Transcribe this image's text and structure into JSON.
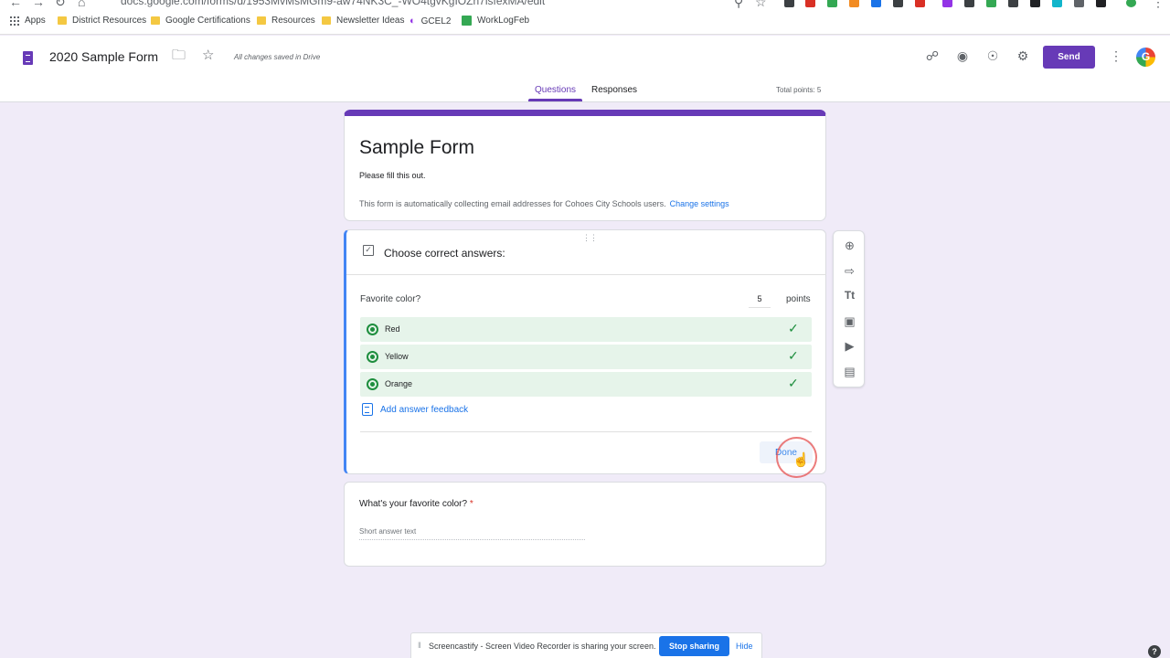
{
  "browser": {
    "url": "docs.google.com/forms/d/1953MvMsMGm9-aw74NK3C_-WO4tgvKgIOZn7lsfexMA/edit",
    "bookmarks": [
      "Apps",
      "District Resources",
      "Google Certifications",
      "Resources",
      "Newsletter Ideas",
      "GCEL2",
      "WorkLogFeb"
    ]
  },
  "header": {
    "doc_title": "2020 Sample Form",
    "saved_status": "All changes saved in Drive",
    "send_label": "Send",
    "avatar_letter": "G",
    "tabs": [
      {
        "label": "Questions",
        "active": true
      },
      {
        "label": "Responses",
        "active": false
      }
    ],
    "total_points": "Total points: 5"
  },
  "form": {
    "title": "Sample Form",
    "description": "Please fill this out.",
    "email_note": "This form is automatically collecting email addresses for Cohoes City Schools users.",
    "change_settings": "Change settings"
  },
  "answer_key": {
    "heading": "Choose correct answers:",
    "question": "Favorite color?",
    "points_value": "5",
    "points_label": "points",
    "options": [
      "Red",
      "Yellow",
      "Orange"
    ],
    "feedback_link": "Add answer feedback",
    "done_label": "Done"
  },
  "question2": {
    "label": "What's your favorite color?",
    "required_mark": "*",
    "placeholder": "Short answer text"
  },
  "share_bar": {
    "message": "Screencastify - Screen Video Recorder is sharing your screen.",
    "stop_label": "Stop sharing",
    "hide_label": "Hide"
  },
  "help_label": "?",
  "colors": {
    "brand": "#673ab7",
    "accent_blue": "#4285f4",
    "correct_green": "#1e8e3e",
    "correct_bg": "#e6f4ea"
  }
}
